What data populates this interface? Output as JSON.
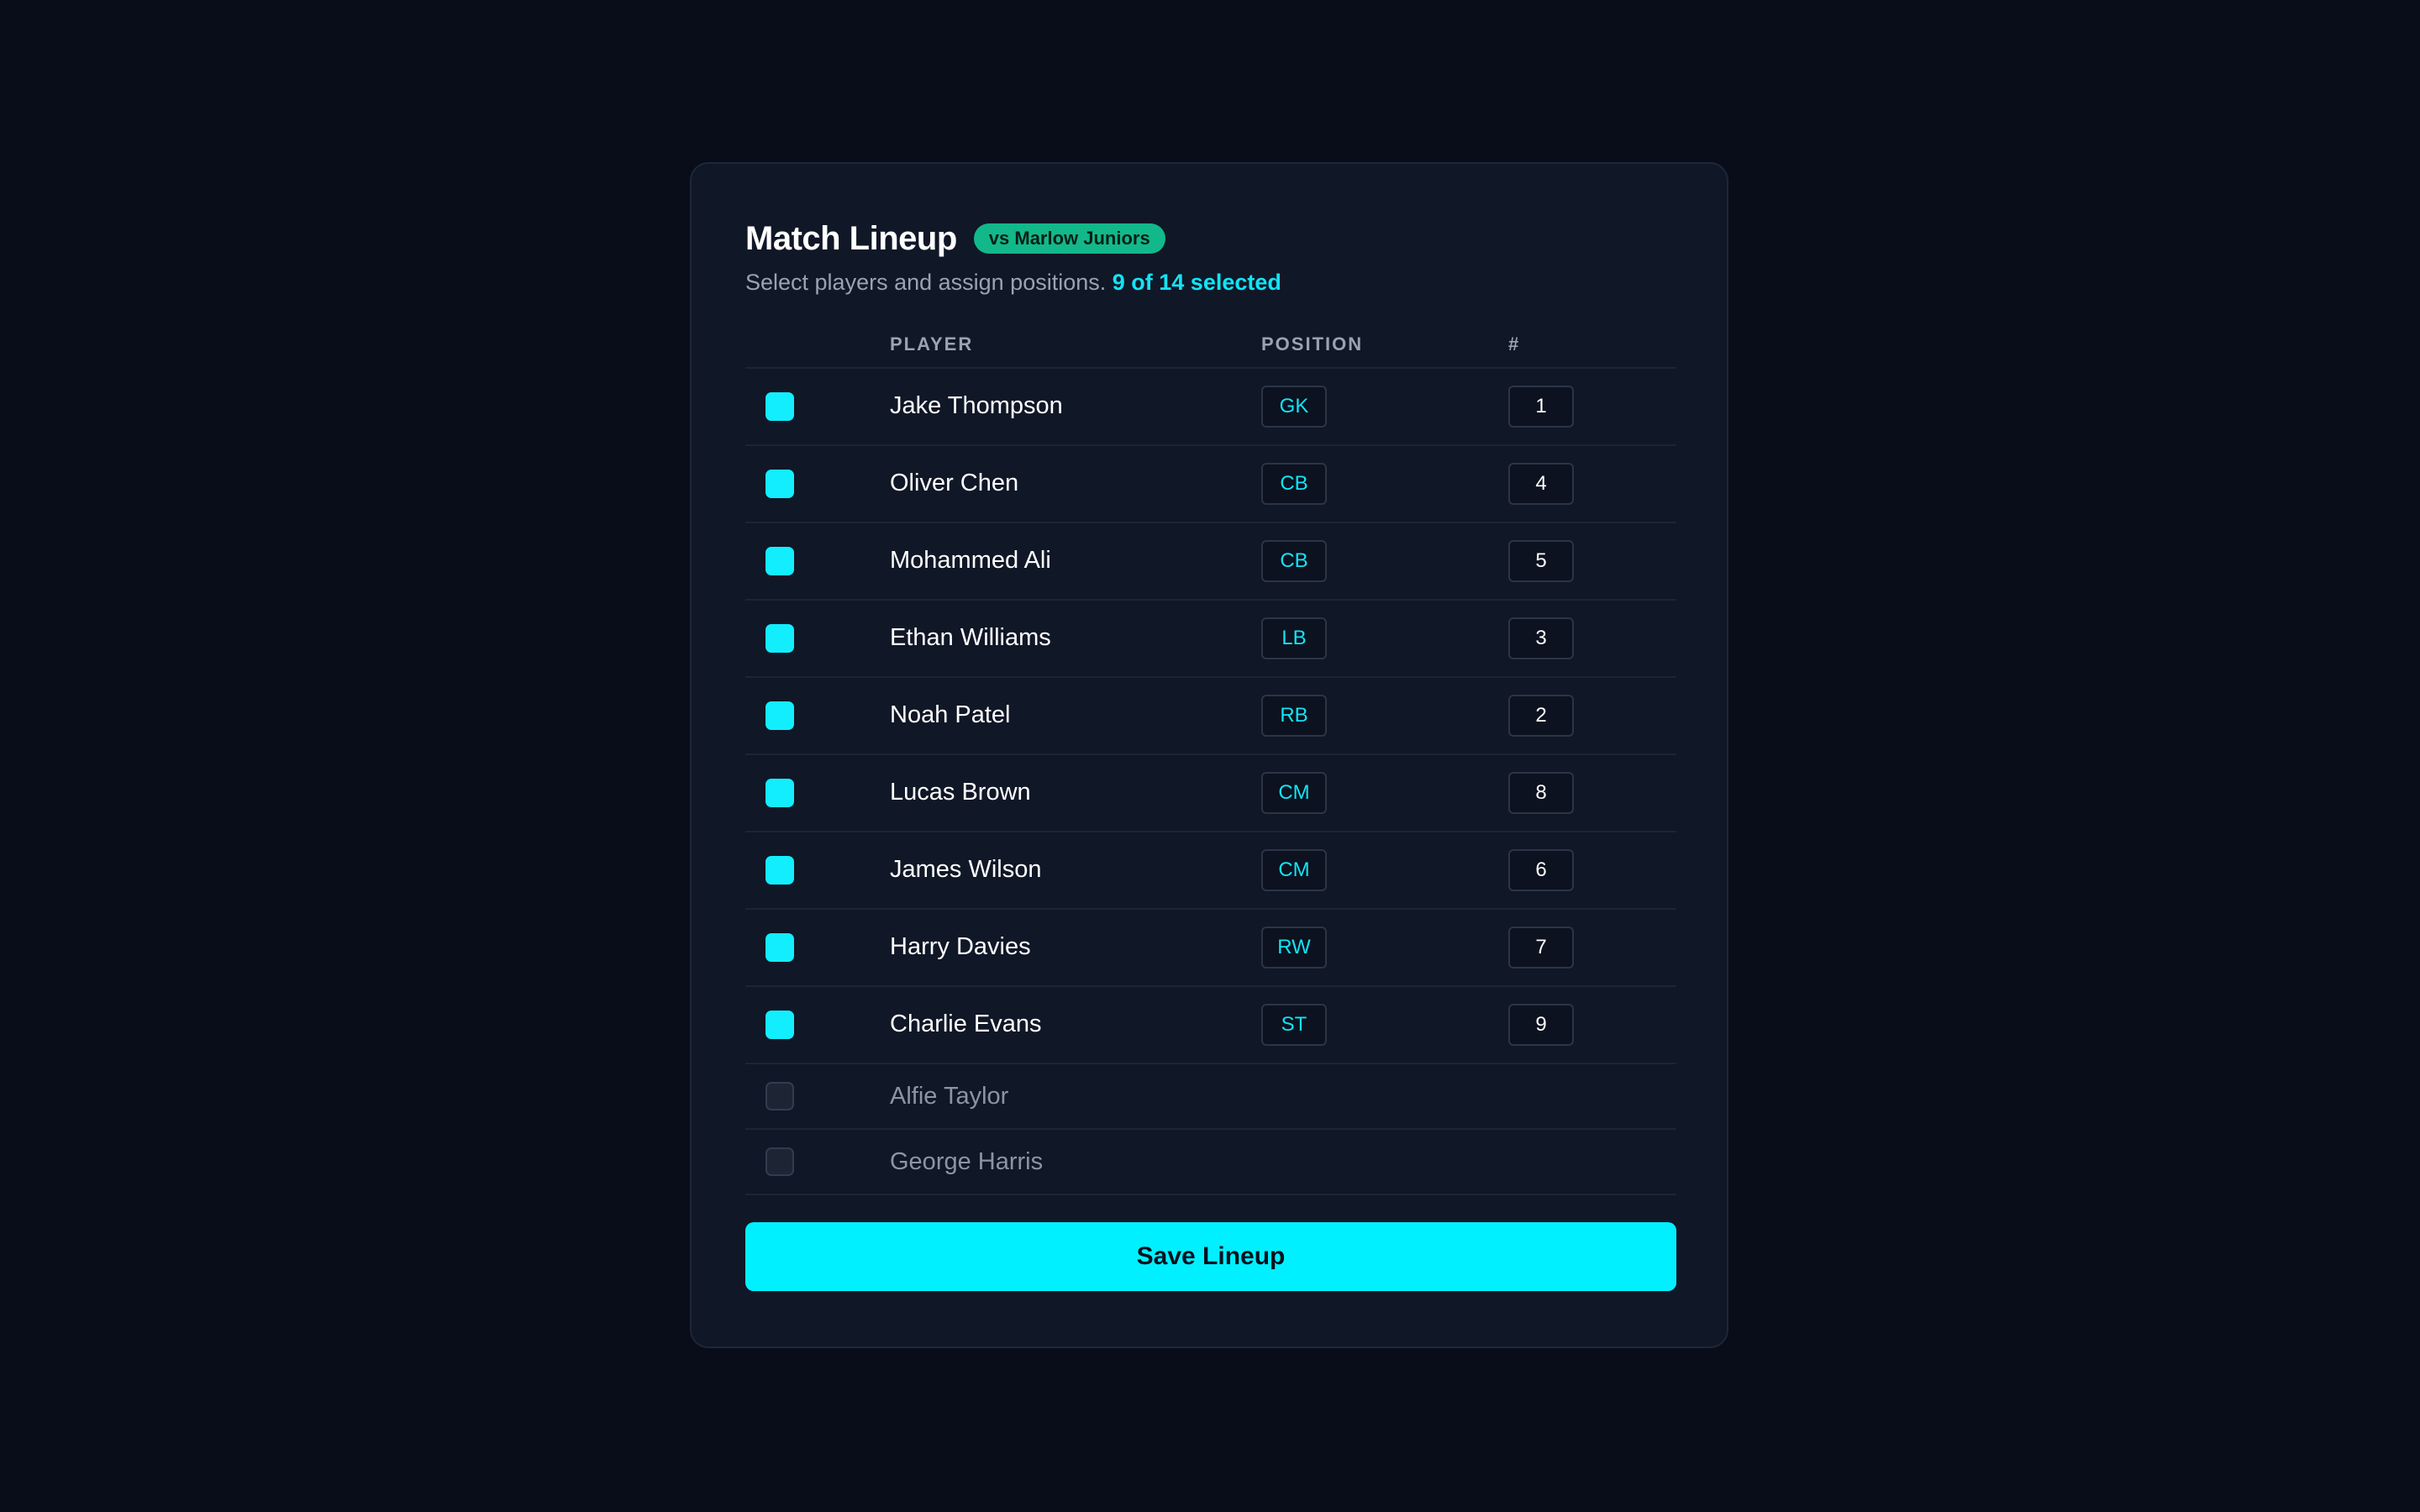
{
  "header": {
    "title": "Match Lineup",
    "opponent_badge": "vs Marlow Juniors",
    "subtitle": "Select players and assign positions.",
    "selected_count": "9 of 14 selected"
  },
  "table": {
    "columns": [
      "",
      "PLAYER",
      "POSITION",
      "#"
    ],
    "rows": [
      {
        "name": "Jake Thompson",
        "selected": true,
        "position": "GK",
        "number": "1"
      },
      {
        "name": "Oliver Chen",
        "selected": true,
        "position": "CB",
        "number": "4"
      },
      {
        "name": "Mohammed Ali",
        "selected": true,
        "position": "CB",
        "number": "5"
      },
      {
        "name": "Ethan Williams",
        "selected": true,
        "position": "LB",
        "number": "3"
      },
      {
        "name": "Noah Patel",
        "selected": true,
        "position": "RB",
        "number": "2"
      },
      {
        "name": "Lucas Brown",
        "selected": true,
        "position": "CM",
        "number": "8"
      },
      {
        "name": "James Wilson",
        "selected": true,
        "position": "CM",
        "number": "6"
      },
      {
        "name": "Harry Davies",
        "selected": true,
        "position": "RW",
        "number": "7"
      },
      {
        "name": "Charlie Evans",
        "selected": true,
        "position": "ST",
        "number": "9"
      },
      {
        "name": "Alfie Taylor",
        "selected": false,
        "position": "",
        "number": ""
      },
      {
        "name": "George Harris",
        "selected": false,
        "position": "",
        "number": ""
      }
    ]
  },
  "actions": {
    "save_label": "Save Lineup"
  },
  "colors": {
    "background": "#080d19",
    "card": "#101727",
    "accent": "#00f0ff",
    "badge": "#13b88a",
    "muted_text": "#9aa3b2"
  }
}
